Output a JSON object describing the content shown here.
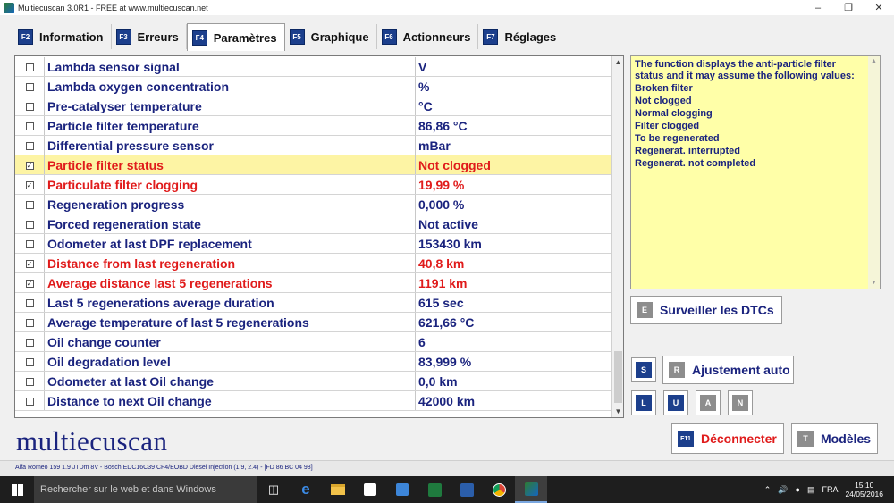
{
  "window": {
    "title": "Multiecuscan 3.0R1 - FREE at www.multiecuscan.net"
  },
  "tabs": [
    {
      "key": "F2",
      "label": "Information"
    },
    {
      "key": "F3",
      "label": "Erreurs"
    },
    {
      "key": "F4",
      "label": "Paramètres",
      "active": true
    },
    {
      "key": "F5",
      "label": "Graphique"
    },
    {
      "key": "F6",
      "label": "Actionneurs"
    },
    {
      "key": "F7",
      "label": "Réglages"
    }
  ],
  "params": [
    {
      "name": "Lambda sensor signal",
      "value": "V",
      "checked": false,
      "selected": false,
      "highlight": false
    },
    {
      "name": "Lambda oxygen concentration",
      "value": "%",
      "checked": false,
      "selected": false,
      "highlight": false
    },
    {
      "name": "Pre-catalyser temperature",
      "value": "°C",
      "checked": false,
      "selected": false,
      "highlight": false
    },
    {
      "name": "Particle filter temperature",
      "value": "86,86 °C",
      "checked": false,
      "selected": false,
      "highlight": false
    },
    {
      "name": "Differential pressure sensor",
      "value": " mBar",
      "checked": false,
      "selected": false,
      "highlight": false
    },
    {
      "name": "Particle filter status",
      "value": "Not clogged",
      "checked": true,
      "selected": true,
      "highlight": true
    },
    {
      "name": "Particulate filter clogging",
      "value": "19,99 %",
      "checked": true,
      "selected": false,
      "highlight": true
    },
    {
      "name": "Regeneration progress",
      "value": "0,000 %",
      "checked": false,
      "selected": false,
      "highlight": false
    },
    {
      "name": "Forced regeneration state",
      "value": "Not active",
      "checked": false,
      "selected": false,
      "highlight": false
    },
    {
      "name": "Odometer at last DPF replacement",
      "value": "153430 km",
      "checked": false,
      "selected": false,
      "highlight": false
    },
    {
      "name": "Distance from last regeneration",
      "value": "40,8 km",
      "checked": true,
      "selected": false,
      "highlight": true
    },
    {
      "name": "Average distance last 5 regenerations",
      "value": "1191 km",
      "checked": true,
      "selected": false,
      "highlight": true
    },
    {
      "name": "Last 5 regenerations average duration",
      "value": "615 sec",
      "checked": false,
      "selected": false,
      "highlight": false
    },
    {
      "name": "Average temperature of last 5 regenerations",
      "value": "621,66 °C",
      "checked": false,
      "selected": false,
      "highlight": false
    },
    {
      "name": "Oil change counter",
      "value": "6",
      "checked": false,
      "selected": false,
      "highlight": false
    },
    {
      "name": "Oil degradation level",
      "value": "83,999 %",
      "checked": false,
      "selected": false,
      "highlight": false
    },
    {
      "name": "Odometer at last Oil change",
      "value": "0,0 km",
      "checked": false,
      "selected": false,
      "highlight": false
    },
    {
      "name": "Distance to next Oil change",
      "value": "42000 km",
      "checked": false,
      "selected": false,
      "highlight": false
    }
  ],
  "info": {
    "description": "The function displays the anti-particle filter status and it may assume the following values:",
    "options": [
      "Broken filter",
      "Not clogged",
      "Normal clogging",
      "Filter clogged",
      "To be regenerated",
      "Regenerat. interrupted",
      "Regenerat. not completed"
    ]
  },
  "buttons": {
    "dtc_key": "E",
    "dtc_label": "Surveiller les DTCs",
    "s_key": "S",
    "auto_key": "R",
    "auto_label": "Ajustement auto",
    "l_key": "L",
    "u_key": "U",
    "a_key": "A",
    "n_key": "N",
    "disconnect_key": "F11",
    "disconnect_label": "Déconnecter",
    "models_key": "T",
    "models_label": "Modèles"
  },
  "logo": "multiecuscan",
  "status": "Alfa Romeo 159 1.9 JTDm 8V - Bosch EDC16C39 CF4/EOBD Diesel Injection (1.9, 2.4) - [FD 86 BC 04 98]",
  "taskbar": {
    "search_placeholder": "Rechercher sur le web et dans Windows",
    "lang": "FRA",
    "time": "15:10",
    "date": "24/05/2016"
  },
  "colors": {
    "label": "#1a237e",
    "alert": "#e01b1b",
    "selected_row": "#fdf4a4",
    "info_bg": "#ffffa8",
    "key_blue": "#1c3f8c"
  }
}
